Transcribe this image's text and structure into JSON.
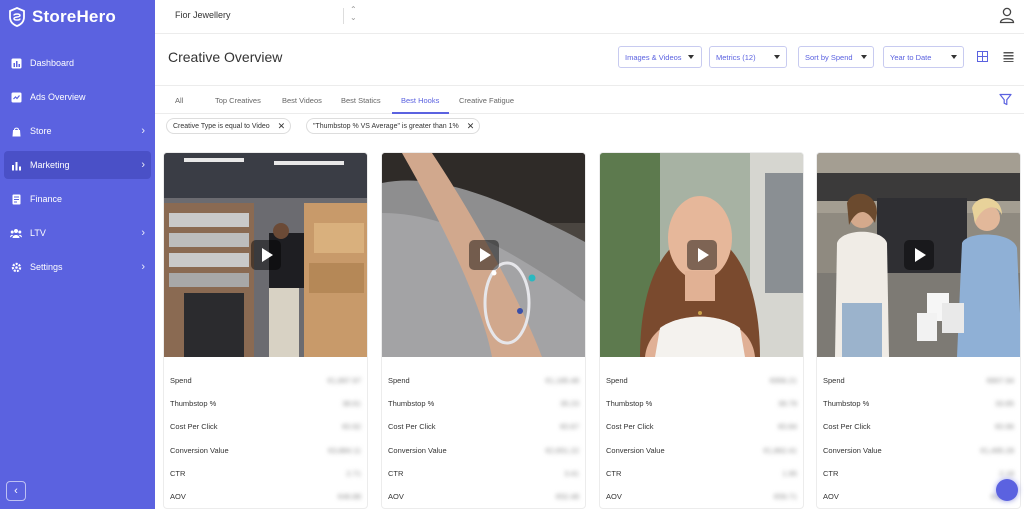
{
  "app": {
    "name": "StoreHero"
  },
  "sidebar": {
    "items": [
      {
        "label": "Dashboard",
        "icon": "dashboard-icon",
        "chevron": false,
        "active": false
      },
      {
        "label": "Ads Overview",
        "icon": "ads-overview-icon",
        "chevron": false,
        "active": false
      },
      {
        "label": "Store",
        "icon": "store-icon",
        "chevron": true,
        "active": false
      },
      {
        "label": "Marketing",
        "icon": "marketing-icon",
        "chevron": true,
        "active": true
      },
      {
        "label": "Finance",
        "icon": "finance-icon",
        "chevron": false,
        "active": false
      },
      {
        "label": "LTV",
        "icon": "ltv-icon",
        "chevron": true,
        "active": false
      },
      {
        "label": "Settings",
        "icon": "settings-icon",
        "chevron": true,
        "active": false
      }
    ]
  },
  "topbar": {
    "store_name": "Fior Jewellery"
  },
  "header": {
    "title": "Creative Overview",
    "dropdowns": {
      "media": "Images & Videos",
      "metrics": "Metrics (12)",
      "sort": "Sort by Spend",
      "period": "Year to Date"
    }
  },
  "tabs": {
    "all": "All",
    "top_creatives": "Top Creatives",
    "best_videos": "Best Videos",
    "best_statics": "Best Statics",
    "best_hooks": "Best Hooks",
    "creative_fatigue": "Creative Fatigue",
    "active": "Best Hooks"
  },
  "filters": {
    "chip1": "Creative Type is equal to Video",
    "chip2": "\"Thumbstop % VS Average\" is greater than 1%"
  },
  "metric_labels": {
    "spend": "Spend",
    "thumbstop": "Thumbstop %",
    "cpc": "Cost Per Click",
    "conversion_value": "Conversion Value",
    "ctr": "CTR",
    "aov": "AOV"
  },
  "cards": [
    {
      "spend": "€1,897.97",
      "thumbstop": "38.61",
      "cpc": "€0.92",
      "conversion_value": "€3,884.11",
      "ctr": "2.71",
      "aov": "€46.88"
    },
    {
      "spend": "€1,185.48",
      "thumbstop": "35.23",
      "cpc": "€0.67",
      "conversion_value": "€2,651.22",
      "ctr": "3.41",
      "aov": "€52.48"
    },
    {
      "spend": "€956.21",
      "thumbstop": "39.79",
      "cpc": "€0.84",
      "conversion_value": "€1,862.41",
      "ctr": "1.95",
      "aov": "€59.71"
    },
    {
      "spend": "€807.94",
      "thumbstop": "33.85",
      "cpc": "€0.96",
      "conversion_value": "€1,495.28",
      "ctr": "2.18",
      "aov": "€48.23"
    }
  ],
  "colors": {
    "brand": "#5b62e0",
    "brand_dark": "#4a50c7"
  }
}
